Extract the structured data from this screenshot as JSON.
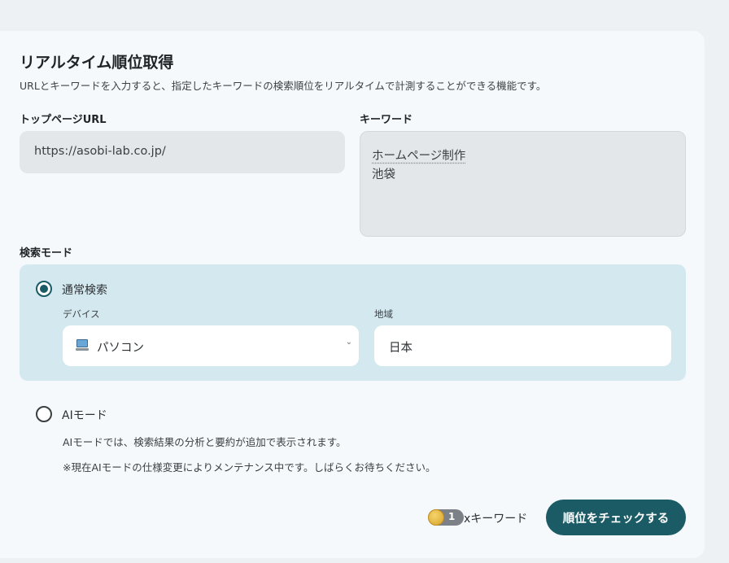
{
  "header": {
    "title": "リアルタイム順位取得",
    "subtitle": "URLとキーワードを入力すると、指定したキーワードの検索順位をリアルタイムで計測することができる機能です。"
  },
  "url_field": {
    "label": "トップページURL",
    "value": "https://asobi-lab.co.jp/"
  },
  "keyword_field": {
    "label": "キーワード",
    "lines": [
      "ホームページ制作",
      "池袋"
    ]
  },
  "search_mode": {
    "label": "検索モード",
    "normal": {
      "label": "通常検索",
      "selected": true,
      "device_label": "デバイス",
      "device_value": "パソコン",
      "device_icon": "computer-icon",
      "region_label": "地域",
      "region_value": "日本"
    },
    "ai": {
      "label": "AIモード",
      "selected": false,
      "note1": "AIモードでは、検索結果の分析と要約が追加で表示されます。",
      "note2": "※現在AIモードの仕様変更によりメンテナンス中です。しばらくお待ちください。"
    }
  },
  "footer": {
    "coin_icon": "coin-icon",
    "coin_count": "1",
    "unit": "xキーワード",
    "check_button": "順位をチェックする"
  },
  "colors": {
    "accent": "#1b5b66",
    "panel": "#d4e8ef",
    "input_bg": "#e3e7ea"
  }
}
